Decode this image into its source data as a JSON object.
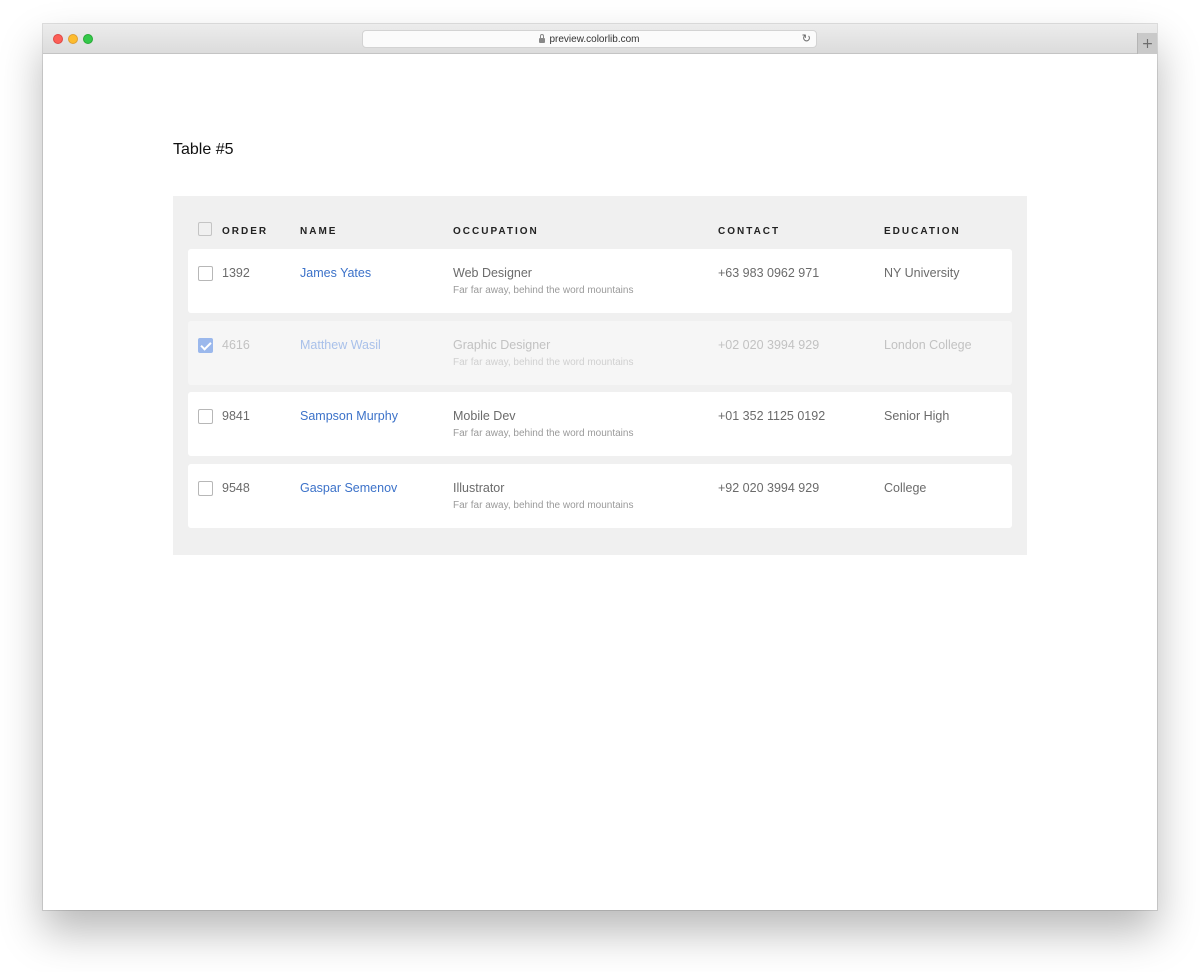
{
  "browser": {
    "url": "preview.colorlib.com",
    "new_tab_label": "+"
  },
  "page": {
    "title": "Table #5"
  },
  "table": {
    "headers": {
      "order": "ORDER",
      "name": "NAME",
      "occupation": "OCCUPATION",
      "contact": "CONTACT",
      "education": "EDUCATION"
    },
    "rows": [
      {
        "order": "1392",
        "name": "James Yates",
        "occupation": "Web Designer",
        "occupation_sub": "Far far away, behind the word mountains",
        "contact": "+63 983 0962 971",
        "education": "NY University",
        "checked": false
      },
      {
        "order": "4616",
        "name": "Matthew Wasil",
        "occupation": "Graphic Designer",
        "occupation_sub": "Far far away, behind the word mountains",
        "contact": "+02 020 3994 929",
        "education": "London College",
        "checked": true
      },
      {
        "order": "9841",
        "name": "Sampson Murphy",
        "occupation": "Mobile Dev",
        "occupation_sub": "Far far away, behind the word mountains",
        "contact": "+01 352 1125 0192",
        "education": "Senior High",
        "checked": false
      },
      {
        "order": "9548",
        "name": "Gaspar Semenov",
        "occupation": "Illustrator",
        "occupation_sub": "Far far away, behind the word mountains",
        "contact": "+92 020 3994 929",
        "education": "College",
        "checked": false
      }
    ]
  },
  "colors": {
    "accent": "#3c72c9",
    "checkbox_checked": "#9bb8ec",
    "table_background": "#f0f0f0"
  }
}
